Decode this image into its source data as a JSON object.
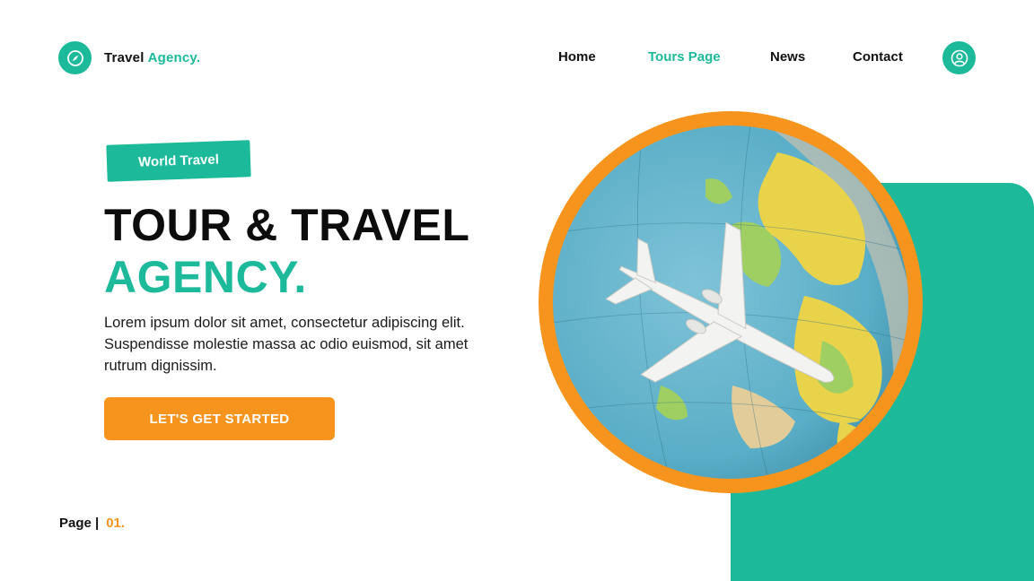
{
  "brand": {
    "name": "Travel",
    "accent": "Agency.",
    "icon": "compass-icon"
  },
  "nav": {
    "items": [
      {
        "label": "Home",
        "active": false
      },
      {
        "label": "Tours Page",
        "active": true
      },
      {
        "label": "News",
        "active": false
      },
      {
        "label": "Contact",
        "active": false
      }
    ],
    "user_icon": "user-icon"
  },
  "hero": {
    "badge": "World Travel",
    "title_line1": "TOUR & TRAVEL",
    "title_line2": "AGENCY.",
    "description": "Lorem ipsum dolor sit amet, consectetur adipiscing elit. Suspendisse molestie massa ac odio euismod, sit amet rutrum dignissim.",
    "cta_label": "LET'S GET STARTED",
    "image": "globe-with-airplane"
  },
  "pagination": {
    "label": "Page |",
    "number": "01."
  },
  "colors": {
    "teal": "#1cb99b",
    "orange": "#f7941d",
    "dark": "#111111"
  }
}
